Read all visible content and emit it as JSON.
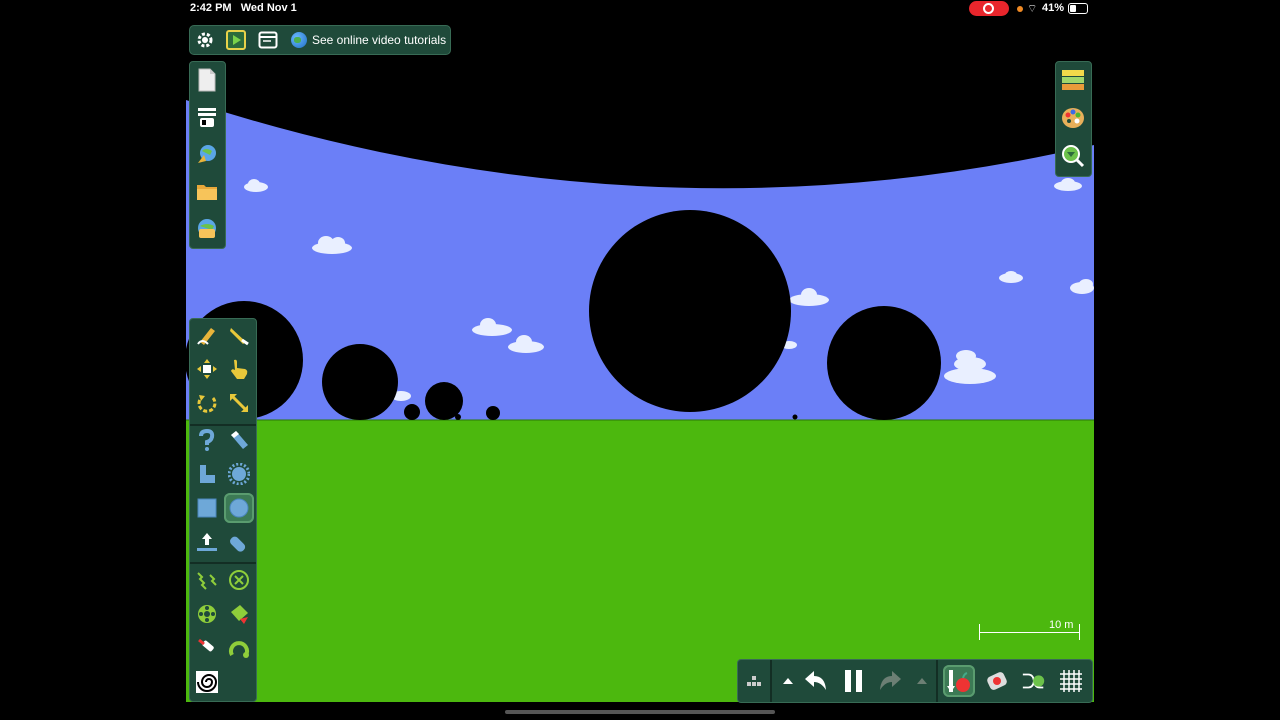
{
  "status_bar": {
    "time": "2:42 PM",
    "date": "Wed Nov 1",
    "battery": "41%",
    "recording": true
  },
  "top_toolbar": {
    "items": [
      "settings-icon",
      "play-scene-icon",
      "window-icon"
    ],
    "tutorial_label": "See online video tutorials"
  },
  "left_file_panel": {
    "items": [
      "new-scene-icon",
      "scene-list-icon",
      "open-online-icon",
      "folder-icon",
      "save-online-icon"
    ]
  },
  "right_panel": {
    "items": [
      "layers-icon",
      "palette-icon",
      "zoom-icon"
    ]
  },
  "tool_panel": {
    "selected": "circle-tool",
    "groups": [
      [
        "pencil-tool",
        "knife-tool",
        "move-tool",
        "drag-tool",
        "rotate-tool",
        "scale-tool"
      ],
      [
        "chain-tool",
        "brush-tool",
        "polygon-tool",
        "gear-tool",
        "box-tool",
        "circle-tool",
        "plane-tool",
        "eraser-tool"
      ],
      [
        "spring-tool",
        "fixate-tool",
        "axle-tool",
        "thruster-tool",
        "laser-tool",
        "hinge-tool",
        "tracer-tool"
      ]
    ]
  },
  "bottom_bar": {
    "items": [
      "grid-dots-icon",
      "up-arrow-icon",
      "undo-icon",
      "pause-icon",
      "redo-icon",
      "up-arrow-icon",
      "gravity-icon",
      "erase-object-icon",
      "randomize-icon",
      "grid-icon"
    ]
  },
  "scale": {
    "label": "10 m"
  },
  "colors": {
    "sky": "#6b7ff7",
    "ground": "#4cb80e",
    "panel": "#1f4a3a",
    "record": "#e8262c"
  }
}
